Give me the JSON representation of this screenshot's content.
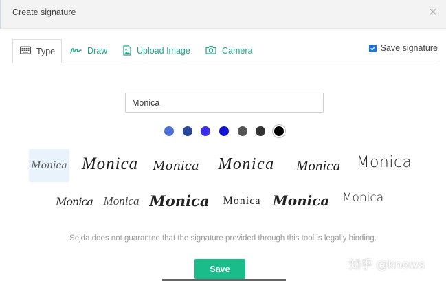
{
  "dialog": {
    "title": "Create signature",
    "close_glyph": "×"
  },
  "tabs": [
    {
      "label": "Type",
      "icon": "keyboard-icon"
    },
    {
      "label": "Draw",
      "icon": "draw-icon"
    },
    {
      "label": "Upload Image",
      "icon": "image-file-icon"
    },
    {
      "label": "Camera",
      "icon": "camera-icon"
    }
  ],
  "save_signature": {
    "label": "Save signature",
    "checked": true
  },
  "name_input": {
    "value": "Monica"
  },
  "colors": [
    "#4c6fd8",
    "#28489a",
    "#3a2ee6",
    "#1212d8",
    "#555555",
    "#333333",
    "#000000"
  ],
  "selected_color": "#000000",
  "signature_text": "Monica",
  "disclaimer": "Sejda does not guarantee that the signature provided through this tool is legally binding.",
  "save_button": "Save",
  "watermark": "知乎 @knows"
}
